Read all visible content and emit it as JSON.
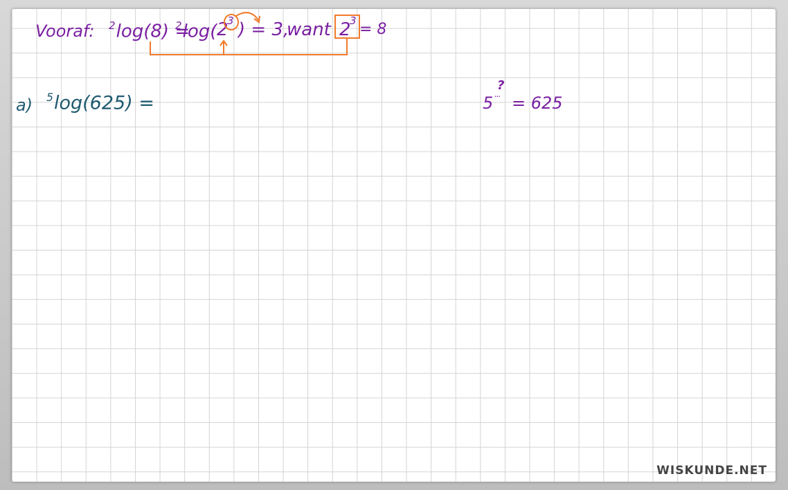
{
  "line1": {
    "label": "Vooraf:",
    "base1": "2",
    "expr1": "log(8) =",
    "base2": "2",
    "expr2": "log(",
    "inner_base": "2",
    "inner_exp": "3",
    "expr3": ") = 3,",
    "word": "want",
    "box_base": "2",
    "box_exp": "3",
    "result": "= 8"
  },
  "line2": {
    "label": "a)",
    "base": "5",
    "expr": "log(625) ="
  },
  "side": {
    "base": "5",
    "question": "?",
    "dots": "...",
    "rest": "= 625"
  },
  "watermark": "WISKUNDE.NET",
  "colors": {
    "purple": "#7a1fa2",
    "teal": "#1f5a70",
    "orange": "#f07a2a",
    "grid": "#d3d3d3"
  }
}
